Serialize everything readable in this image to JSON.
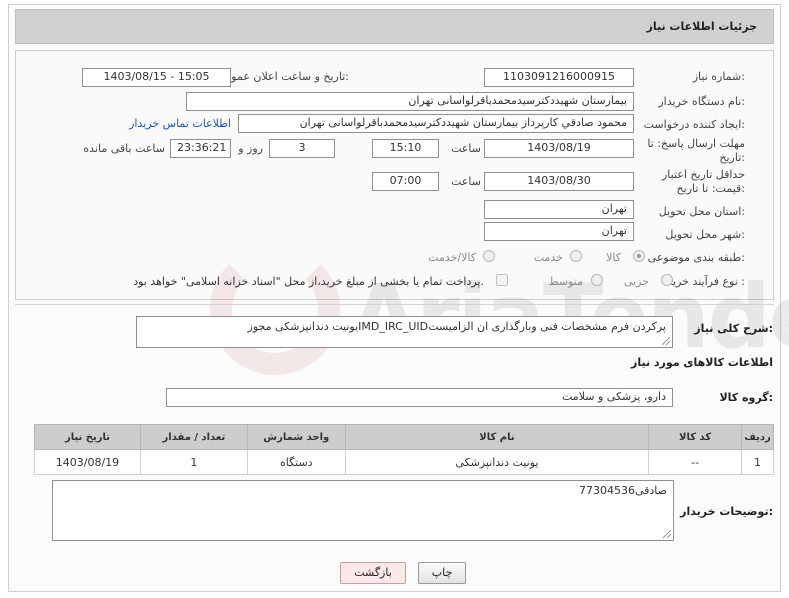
{
  "header": {
    "title": "جزئیات اطلاعات نیاز"
  },
  "labels": {
    "need_number": "شماره نیاز:",
    "announce_datetime": "تاریخ و ساعت اعلان عمومی:",
    "buyer_org": "نام دستگاه خریدار:",
    "creator": "ایجاد کننده درخواست:",
    "contact_link": "اطلاعات تماس خریدار",
    "deadline": "مهلت ارسال پاسخ: تا تاریخ:",
    "min_validity": "حداقل تاریخ اعتبار قیمت: تا تاریخ:",
    "hour": "ساعت",
    "day_and": "روز و",
    "time_left": "ساعت باقی مانده",
    "province": "استان محل تحویل:",
    "city": "شهر محل تحویل:",
    "category": "طبقه بندی موضوعی:",
    "purchase_type": "نوع فرآیند خرید :",
    "general_desc": "شرح کلی نیاز:",
    "goods_info": "اطلاعات کالاهای مورد نیاز",
    "goods_group": "گروه کالا:",
    "buyer_notes": "توضیحات خریدار:"
  },
  "fields": {
    "need_number": "1103091216000915",
    "announce_datetime": "1403/08/15 - 15:05",
    "buyer_org": "بیمارستان شهیددکترسیدمحمدباقرلواسانی تهران",
    "creator": "محمود صادقي کارپرداز بیمارستان شهیددکترسیدمحمدباقرلواسانی تهران",
    "deadline_date": "1403/08/19",
    "deadline_time": "15:10",
    "days_left": "3",
    "time_left": "23:36:21",
    "validity_date": "1403/08/30",
    "validity_time": "07:00",
    "province": "تهران",
    "city": "تهران",
    "general_desc": "یونیت دندانپزشکی مجوزIMD_IRC_UIDپرکردن فرم مشخصات فنی وبارگذاری ان الزامیست",
    "goods_group": "دارو، پزشکی و سلامت",
    "buyer_notes": "77304536صادقی"
  },
  "category_options": [
    {
      "label": "کالا",
      "selected": true
    },
    {
      "label": "خدمت",
      "selected": false
    },
    {
      "label": "کالا/خدمت",
      "selected": false
    }
  ],
  "purchase_options": [
    {
      "label": "جزیی",
      "selected": false
    },
    {
      "label": "متوسط",
      "selected": false
    }
  ],
  "payment_note": "پرداخت تمام یا بخشی از مبلغ خرید،از محل \"اسناد خزانه اسلامی\" خواهد بود.",
  "table": {
    "headers": [
      "ردیف",
      "کد کالا",
      "نام کالا",
      "واحد شمارش",
      "تعداد / مقدار",
      "تاریخ نیاز"
    ],
    "rows": [
      [
        "1",
        "--",
        "یونیت دندانپزشکی",
        "دستگاه",
        "1",
        "1403/08/19"
      ]
    ]
  },
  "buttons": {
    "print": "چاپ",
    "back": "بازگشت"
  },
  "watermark": "AriaTender.neT"
}
